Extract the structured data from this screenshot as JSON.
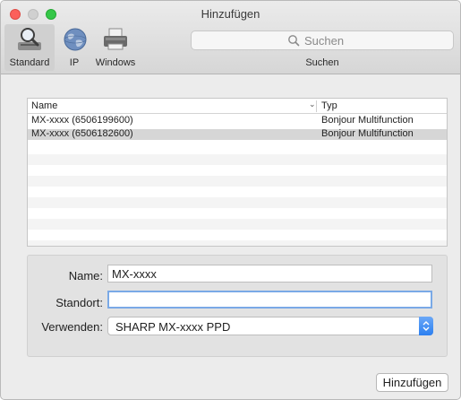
{
  "window": {
    "title": "Hinzufügen"
  },
  "toolbar": {
    "standard_label": "Standard",
    "ip_label": "IP",
    "windows_label": "Windows",
    "search_placeholder": "Suchen",
    "search_label": "Suchen"
  },
  "printer_list": {
    "columns": {
      "name": "Name",
      "type": "Typ"
    },
    "rows": [
      {
        "name": "MX-xxxx (6506199600)",
        "type": "Bonjour Multifunction"
      },
      {
        "name": "MX-xxxx (6506182600)",
        "type": "Bonjour Multifunction"
      }
    ]
  },
  "form": {
    "name_label": "Name:",
    "name_value": "MX-xxxx",
    "location_label": "Standort:",
    "location_value": "",
    "use_label": "Verwenden:",
    "use_value": "SHARP MX-xxxx PPD"
  },
  "add_button_label": "Hinzufügen",
  "colors": {
    "selection_row": "#d6d6d6",
    "focus_ring": "#7aa9e6",
    "select_arrow": "#2c7ff0"
  }
}
